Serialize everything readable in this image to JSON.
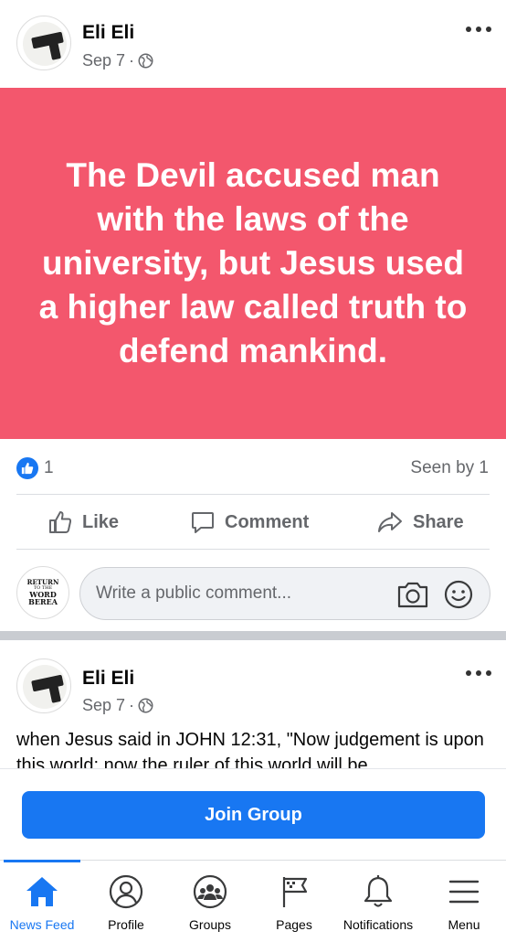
{
  "post1": {
    "author": "Eli Eli",
    "date": "Sep 7",
    "separator": "·",
    "privacy_icon": "globe-icon",
    "banner_text": "The Devil accused man with the laws of the university, but Jesus used a higher law called truth to defend mankind.",
    "banner_color": "#f3576d",
    "like_count": "1",
    "seen_by": "Seen by 1"
  },
  "actions": {
    "like": "Like",
    "comment": "Comment",
    "share": "Share"
  },
  "comment_box": {
    "avatar_lines": [
      "RETURN",
      "TO THE",
      "WORD",
      "BEREA"
    ],
    "placeholder": "Write a public comment..."
  },
  "post2": {
    "author": "Eli Eli",
    "date": "Sep 7",
    "separator": "·",
    "text": "when Jesus said in JOHN 12:31, \"Now judgement is upon this world; now the ruler of this world will be"
  },
  "join_button": "Join Group",
  "accent_color": "#1877f2",
  "tabs": [
    {
      "label": "News Feed",
      "icon": "home-icon",
      "active": true
    },
    {
      "label": "Profile",
      "icon": "profile-icon",
      "active": false
    },
    {
      "label": "Groups",
      "icon": "groups-icon",
      "active": false
    },
    {
      "label": "Pages",
      "icon": "flag-icon",
      "active": false
    },
    {
      "label": "Notifications",
      "icon": "bell-icon",
      "active": false
    },
    {
      "label": "Menu",
      "icon": "menu-icon",
      "active": false
    }
  ]
}
